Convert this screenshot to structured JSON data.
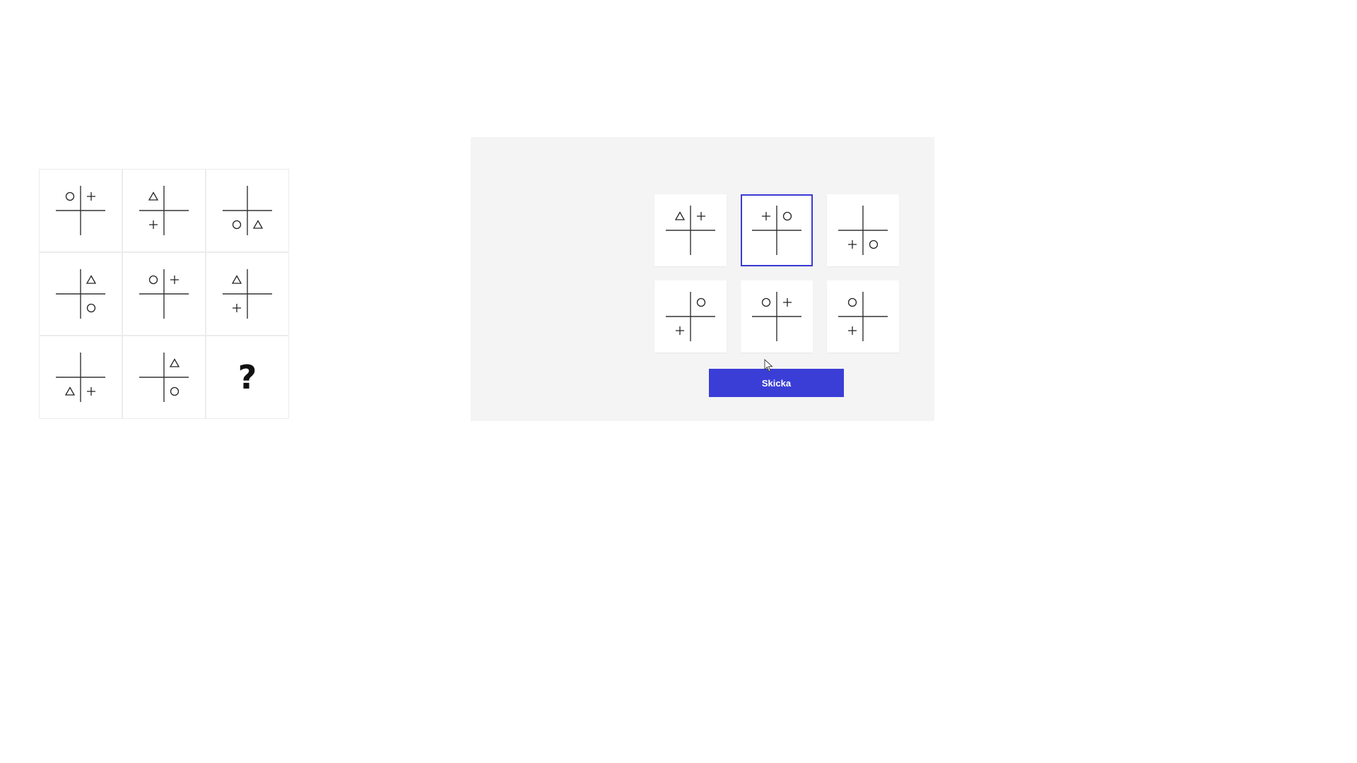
{
  "puzzle": {
    "cells": [
      {
        "tl": "circle",
        "tr": "plus",
        "bl": "",
        "br": ""
      },
      {
        "tl": "triangle",
        "tr": "",
        "bl": "plus",
        "br": ""
      },
      {
        "tl": "",
        "tr": "",
        "bl": "circle",
        "br": "triangle"
      },
      {
        "tl": "",
        "tr": "triangle",
        "bl": "",
        "br": "circle"
      },
      {
        "tl": "circle",
        "tr": "plus",
        "bl": "",
        "br": ""
      },
      {
        "tl": "triangle",
        "tr": "",
        "bl": "plus",
        "br": ""
      },
      {
        "tl": "",
        "tr": "",
        "bl": "triangle",
        "br": "plus"
      },
      {
        "tl": "",
        "tr": "triangle",
        "bl": "",
        "br": "circle"
      },
      {
        "question": "?"
      }
    ]
  },
  "options": [
    {
      "tl": "triangle",
      "tr": "plus",
      "bl": "",
      "br": "",
      "selected": false
    },
    {
      "tl": "plus",
      "tr": "circle",
      "bl": "",
      "br": "",
      "selected": true
    },
    {
      "tl": "",
      "tr": "",
      "bl": "plus",
      "br": "circle",
      "selected": false
    },
    {
      "tl": "",
      "tr": "circle",
      "bl": "plus",
      "br": "",
      "selected": false
    },
    {
      "tl": "circle",
      "tr": "plus",
      "bl": "",
      "br": "",
      "selected": false
    },
    {
      "tl": "circle",
      "tr": "",
      "bl": "plus",
      "br": "",
      "selected": false
    }
  ],
  "submit": {
    "label": "Skicka"
  },
  "colors": {
    "accent": "#3a3ed6",
    "panel_bg": "#f4f4f4"
  }
}
